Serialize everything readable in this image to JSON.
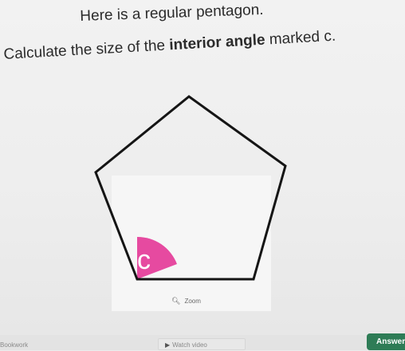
{
  "question": {
    "line1": "Here is a regular pentagon.",
    "line2_prefix": "Calculate the size of the",
    "line2_bold": "interior angle",
    "line2_suffix": "marked c."
  },
  "figure": {
    "angle_label": "c",
    "pentagon_stroke": "#151515",
    "highlight_color": "#e64aa0"
  },
  "zoom_button": {
    "icon": "zoom-icon",
    "label": "Zoom"
  },
  "bottom": {
    "left_link": "Bookwork",
    "watch_video": {
      "icon": "video-icon",
      "label": "Watch video"
    },
    "answer_button": "Answer"
  },
  "colors": {
    "accent": "#2e7c56"
  }
}
